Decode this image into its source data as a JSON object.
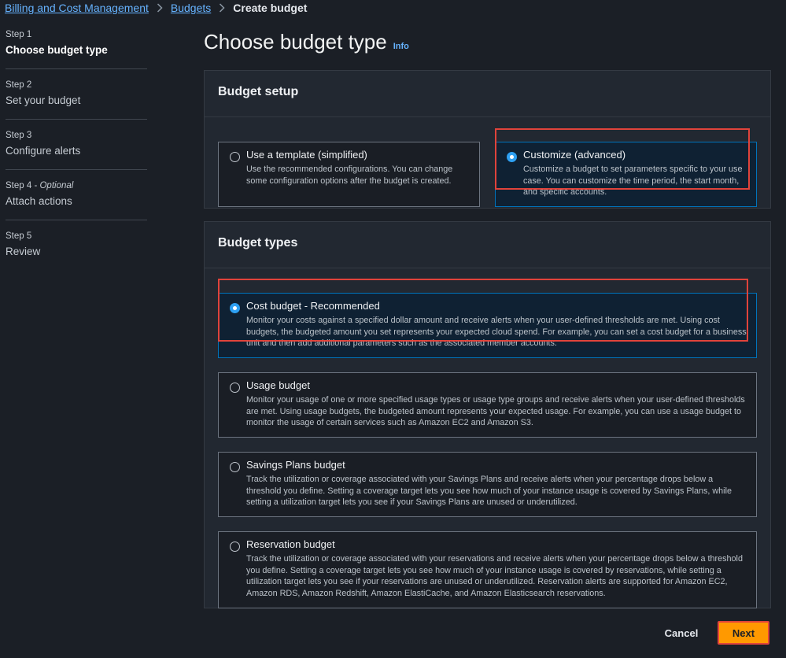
{
  "breadcrumb": {
    "items": [
      "Billing and Cost Management",
      "Budgets"
    ],
    "current": "Create budget"
  },
  "steps": [
    {
      "num": "Step 1",
      "optional": "",
      "name": "Choose budget type"
    },
    {
      "num": "Step 2",
      "optional": "",
      "name": "Set your budget"
    },
    {
      "num": "Step 3",
      "optional": "",
      "name": "Configure alerts"
    },
    {
      "num": "Step 4",
      "optional": "Optional",
      "name": "Attach actions"
    },
    {
      "num": "Step 5",
      "optional": "",
      "name": "Review"
    }
  ],
  "page": {
    "title": "Choose budget type",
    "info": "Info"
  },
  "setup": {
    "header": "Budget setup",
    "options": [
      {
        "title": "Use a template (simplified)",
        "desc": "Use the recommended configurations. You can change some configuration options after the budget is created.",
        "selected": false
      },
      {
        "title": "Customize (advanced)",
        "desc": "Customize a budget to set parameters specific to your use case. You can customize the time period, the start month, and specific accounts.",
        "selected": true
      }
    ]
  },
  "types": {
    "header": "Budget types",
    "options": [
      {
        "title": "Cost budget - Recommended",
        "desc": "Monitor your costs against a specified dollar amount and receive alerts when your user-defined thresholds are met. Using cost budgets, the budgeted amount you set represents your expected cloud spend. For example, you can set a cost budget for a business unit and then add additional parameters such as the associated member accounts.",
        "selected": true
      },
      {
        "title": "Usage budget",
        "desc": "Monitor your usage of one or more specified usage types or usage type groups and receive alerts when your user-defined thresholds are met. Using usage budgets, the budgeted amount represents your expected usage. For example, you can use a usage budget to monitor the usage of certain services such as Amazon EC2 and Amazon S3.",
        "selected": false
      },
      {
        "title": "Savings Plans budget",
        "desc": "Track the utilization or coverage associated with your Savings Plans and receive alerts when your percentage drops below a threshold you define. Setting a coverage target lets you see how much of your instance usage is covered by Savings Plans, while setting a utilization target lets you see if your Savings Plans are unused or underutilized.",
        "selected": false
      },
      {
        "title": "Reservation budget",
        "desc": "Track the utilization or coverage associated with your reservations and receive alerts when your percentage drops below a threshold you define. Setting a coverage target lets you see how much of your instance usage is covered by reservations, while setting a utilization target lets you see if your reservations are unused or underutilized. Reservation alerts are supported for Amazon EC2, Amazon RDS, Amazon Redshift, Amazon ElastiCache, and Amazon Elasticsearch reservations.",
        "selected": false
      }
    ]
  },
  "actions": {
    "cancel": "Cancel",
    "next": "Next"
  },
  "colors": {
    "accent": "#ff9900",
    "link": "#66b3ff",
    "highlight": "#e0433b",
    "selected_radio": "#2ea0f2"
  }
}
